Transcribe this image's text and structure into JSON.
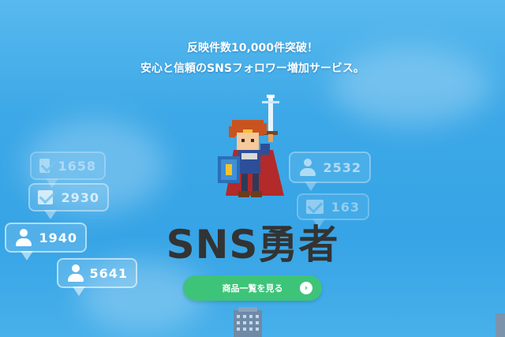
{
  "headline": {
    "line1": "反映件数10,000件突破！",
    "line2": "安心と信頼のSNSフォロワー増加サービス。"
  },
  "title": "SNS勇者",
  "cta": {
    "label": "商品一覧を見る",
    "arrow": "›"
  },
  "bubbles": [
    {
      "count": "1940",
      "icon": "user-icon"
    },
    {
      "count": "5641",
      "icon": "user-icon"
    },
    {
      "count": "2930",
      "icon": "mail-icon"
    },
    {
      "count": "1658",
      "icon": "mail-icon"
    },
    {
      "count": "2532",
      "icon": "user-icon"
    },
    {
      "count": "163",
      "icon": "mail-icon"
    }
  ],
  "colors": {
    "sky": "#3ca8e7",
    "cta": "#3ec479",
    "title": "#333333"
  }
}
